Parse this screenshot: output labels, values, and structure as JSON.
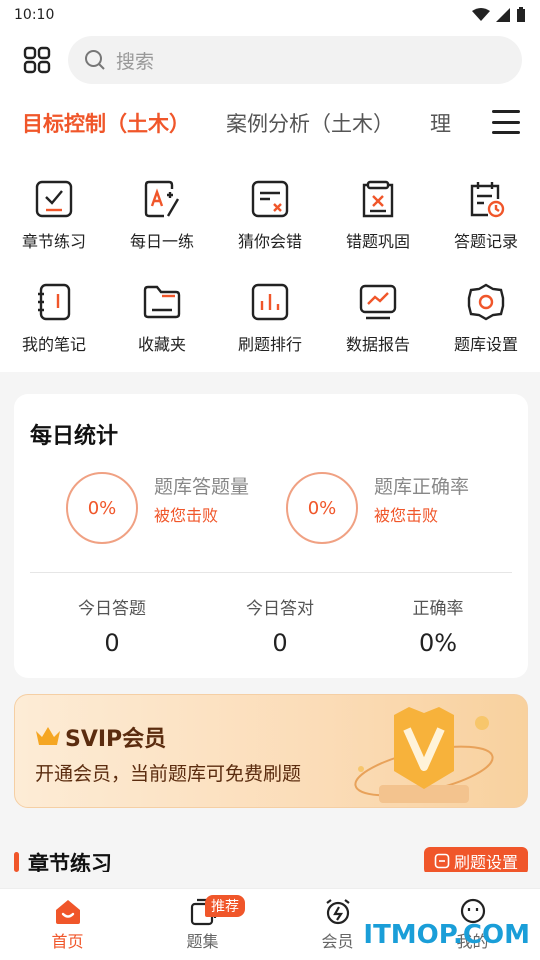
{
  "status": {
    "time": "10:10"
  },
  "search": {
    "placeholder": "搜索"
  },
  "tabs": [
    {
      "label": "目标控制（土木）",
      "active": true
    },
    {
      "label": "案例分析（土木）",
      "active": false
    },
    {
      "label": "理",
      "active": false
    }
  ],
  "features": [
    {
      "label": "章节练习",
      "icon": "chapter-practice-icon"
    },
    {
      "label": "每日一练",
      "icon": "daily-practice-icon"
    },
    {
      "label": "猜你会错",
      "icon": "guess-wrong-icon"
    },
    {
      "label": "错题巩固",
      "icon": "wrong-review-icon"
    },
    {
      "label": "答题记录",
      "icon": "answer-record-icon"
    },
    {
      "label": "我的笔记",
      "icon": "notes-icon"
    },
    {
      "label": "收藏夹",
      "icon": "folder-icon"
    },
    {
      "label": "刷题排行",
      "icon": "ranking-icon"
    },
    {
      "label": "数据报告",
      "icon": "report-icon"
    },
    {
      "label": "题库设置",
      "icon": "settings-icon"
    }
  ],
  "daily_stats": {
    "title": "每日统计",
    "ring1": {
      "value": "0%",
      "label": "题库答题量",
      "sub": "被您击败"
    },
    "ring2": {
      "value": "0%",
      "label": "题库正确率",
      "sub": "被您击败"
    },
    "today": [
      {
        "title": "今日答题",
        "value": "0"
      },
      {
        "title": "今日答对",
        "value": "0"
      },
      {
        "title": "正确率",
        "value": "0%"
      }
    ]
  },
  "svip": {
    "title": "SVIP会员",
    "subtitle": "开通会员，当前题库可免费刷题"
  },
  "section": {
    "title": "章节练习",
    "button": "刷题设置"
  },
  "bottom_nav": [
    {
      "label": "首页",
      "active": true
    },
    {
      "label": "题集",
      "active": false,
      "badge": "推荐"
    },
    {
      "label": "会员",
      "active": false
    },
    {
      "label": "我的",
      "active": false
    }
  ],
  "watermark": "ITMOP.COM",
  "colors": {
    "accent": "#f0562a",
    "vip_text": "#5b2c0f",
    "watermark": "#1a9ed8"
  }
}
